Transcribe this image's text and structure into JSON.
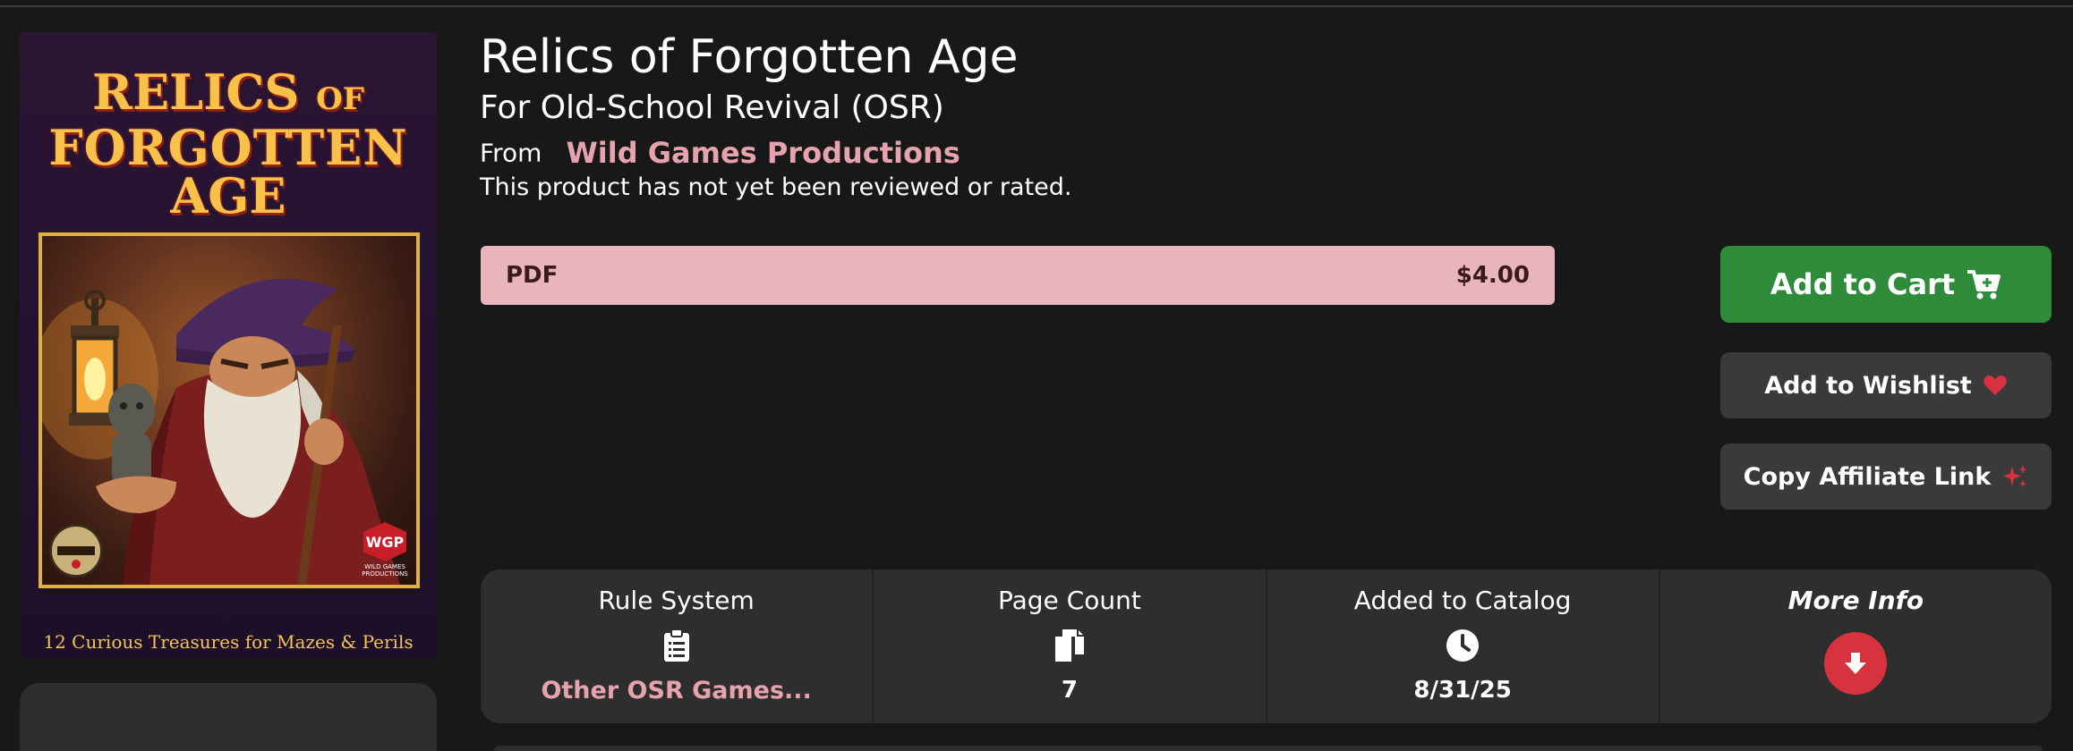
{
  "product": {
    "title": "Relics of Forgotten Age",
    "subtitle": "For Old-School Revival (OSR)",
    "from_label": "From",
    "publisher": "Wild Games Productions",
    "review_status": "This product has not yet been reviewed or rated."
  },
  "cover": {
    "title_line1": "RELICS",
    "title_of": "OF",
    "title_line2": "FORGOTTEN",
    "title_line3": "AGE",
    "tagline": "12 Curious Treasures for Mazes & Perils",
    "badge": "WGP",
    "badge_text_1": "WILD GAMES",
    "badge_text_2": "PRODUCTIONS"
  },
  "format": {
    "label": "PDF",
    "price": "$4.00"
  },
  "actions": {
    "add_to_cart": "Add to Cart",
    "add_to_wishlist": "Add to Wishlist",
    "copy_affiliate": "Copy Affiliate Link"
  },
  "info": {
    "rule_system_label": "Rule System",
    "rule_system_value": "Other OSR Games...",
    "page_count_label": "Page Count",
    "page_count_value": "7",
    "added_label": "Added to Catalog",
    "added_value": "8/31/25",
    "more_info_label": "More Info"
  },
  "colors": {
    "accent_pink": "#e7a3ad",
    "cart_green": "#2e8b3a",
    "more_red": "#d9323f",
    "background": "#181818"
  },
  "icons": {
    "cart": "cart-icon",
    "wishlist": "heart-icon",
    "affiliate": "sparkle-icon",
    "rule_system": "clipboard-icon",
    "page_count": "copy-pages-icon",
    "added": "clock-icon",
    "more_info": "arrow-down-icon"
  }
}
